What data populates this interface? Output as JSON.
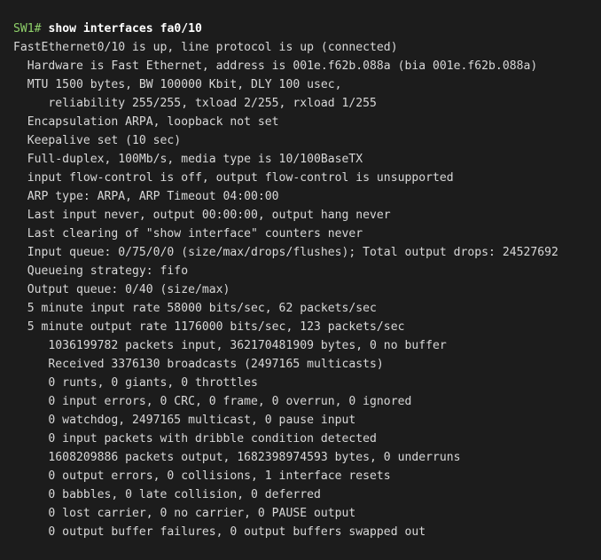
{
  "terminal": {
    "prompt": "SW1#",
    "command": "show interfaces fa0/10",
    "output_lines": [
      "FastEthernet0/10 is up, line protocol is up (connected)",
      "  Hardware is Fast Ethernet, address is 001e.f62b.088a (bia 001e.f62b.088a)",
      "  MTU 1500 bytes, BW 100000 Kbit, DLY 100 usec,",
      "     reliability 255/255, txload 2/255, rxload 1/255",
      "  Encapsulation ARPA, loopback not set",
      "  Keepalive set (10 sec)",
      "  Full-duplex, 100Mb/s, media type is 10/100BaseTX",
      "  input flow-control is off, output flow-control is unsupported",
      "  ARP type: ARPA, ARP Timeout 04:00:00",
      "  Last input never, output 00:00:00, output hang never",
      "  Last clearing of \"show interface\" counters never",
      "  Input queue: 0/75/0/0 (size/max/drops/flushes); Total output drops: 24527692",
      "  Queueing strategy: fifo",
      "  Output queue: 0/40 (size/max)",
      "  5 minute input rate 58000 bits/sec, 62 packets/sec",
      "  5 minute output rate 1176000 bits/sec, 123 packets/sec",
      "     1036199782 packets input, 362170481909 bytes, 0 no buffer",
      "     Received 3376130 broadcasts (2497165 multicasts)",
      "     0 runts, 0 giants, 0 throttles",
      "     0 input errors, 0 CRC, 0 frame, 0 overrun, 0 ignored",
      "     0 watchdog, 2497165 multicast, 0 pause input",
      "     0 input packets with dribble condition detected",
      "     1608209886 packets output, 1682398974593 bytes, 0 underruns",
      "     0 output errors, 0 collisions, 1 interface resets",
      "     0 babbles, 0 late collision, 0 deferred",
      "     0 lost carrier, 0 no carrier, 0 PAUSE output",
      "     0 output buffer failures, 0 output buffers swapped out"
    ]
  },
  "colors": {
    "background": "#1c1c1c",
    "prompt": "#8fd16a",
    "command": "#ffffff",
    "text": "#d8d8d8"
  }
}
